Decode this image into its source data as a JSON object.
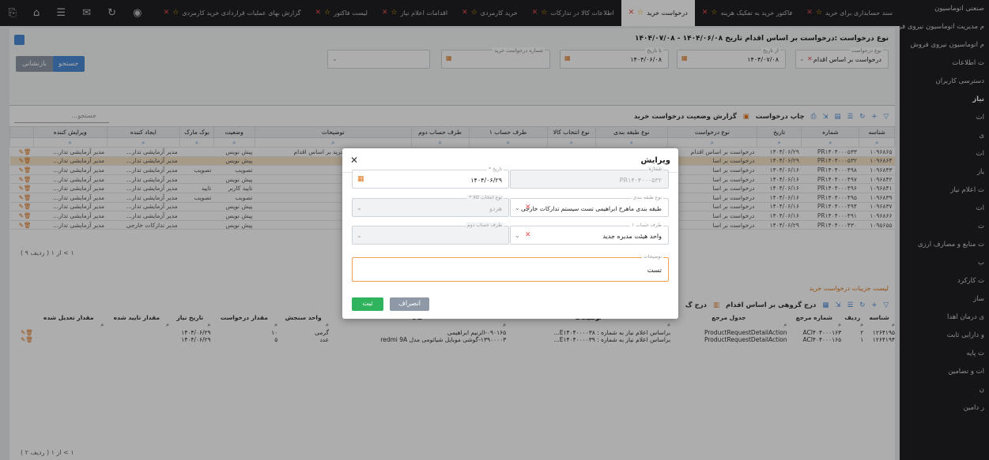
{
  "sidebar": {
    "items": [
      {
        "label": "صنعتی اتوماسیون",
        "bold": false
      },
      {
        "label": "م مدیریت اتوماسیون نیروی فروش",
        "bold": false
      },
      {
        "label": "م اتوماسیون نیروی فروش",
        "bold": false
      },
      {
        "label": "ت اطلاعات",
        "bold": false
      },
      {
        "label": "دسترسی کاربران",
        "bold": false
      },
      {
        "label": "نیاز",
        "bold": true
      },
      {
        "label": "ات",
        "bold": false
      },
      {
        "label": "ی",
        "bold": false
      },
      {
        "label": "ات",
        "bold": false
      },
      {
        "label": "یاز",
        "bold": false
      },
      {
        "label": "ت اعلام نیاز",
        "bold": false
      },
      {
        "label": "ات",
        "bold": false
      },
      {
        "label": "ت",
        "bold": false
      },
      {
        "label": "ت منابع و مصارف ارزی",
        "bold": false
      },
      {
        "label": "ب",
        "bold": false
      },
      {
        "label": "ت کارکرد",
        "bold": false
      },
      {
        "label": "ساز",
        "bold": false
      },
      {
        "label": "ی درمان اهدا",
        "bold": false
      },
      {
        "label": "و دارایی ثابت",
        "bold": false
      },
      {
        "label": "ت پایه",
        "bold": false
      },
      {
        "label": "ات و تضامین",
        "bold": false
      },
      {
        "label": "ن",
        "bold": false
      },
      {
        "label": "ر دامین",
        "bold": false
      }
    ]
  },
  "tabs": [
    {
      "label": "سند حسابداری برای خرید",
      "active": false
    },
    {
      "label": "فاکتور خرید به تفکیک هزینه",
      "active": false
    },
    {
      "label": "درخواست خرید",
      "active": true
    },
    {
      "label": "اطلاعات کالا در تدارکات",
      "active": false
    },
    {
      "label": "خرید کارمزدی",
      "active": false
    },
    {
      "label": "اقدامات اعلام نیاز",
      "active": false
    },
    {
      "label": "لیست فاکتور",
      "active": false
    },
    {
      "label": "گزارش بهای عملیات قراردادی خرید کارمزدی",
      "active": false
    },
    {
      "label": "سفارش خرید کارمزدی",
      "active": false
    }
  ],
  "filter": {
    "title": "نوع درخواست :درخواست بر اساس اقدام   تاریخ ۱۴۰۴/۰۶/۰۸ - ۱۴۰۴/۰۷/۰۸",
    "request_type_label": "نوع درخواست",
    "request_type_value": "درخواست بر اساس اقدام",
    "date_from_label": "از تاریخ",
    "date_from_value": "۱۴۰۴/۰۶/۰۸",
    "date_to_label": "تا تاریخ",
    "date_to_value": "۱۴۰۴/۰۷/۰۸",
    "request_no_label": "شماره درخواست خرید",
    "search_button": "جستجو",
    "reset_button": "بازنشانی"
  },
  "toolbar": {
    "print": "چاپ درخواست",
    "report": "گزارش وضعیت درخواست خرید",
    "search_placeholder": "جستجو..."
  },
  "grid": {
    "headers": [
      "شناسه",
      "شماره",
      "تاریخ",
      "نوع درخواست",
      "نوع طبقه بندی",
      "نوع انتخاب کالا",
      "طرف حساب ۱",
      "طرف حساب دوم",
      "توضیحات",
      "وضعیت",
      "بوک مارک",
      "ایجاد کننده",
      "ویرایش کننده"
    ],
    "filter_all": "(همه)",
    "rows": [
      [
        "۱۰۹۶۸۶۵",
        "PR۱۴۰۴۰۰۰۵۳۳",
        "۱۴۰۴/۰۶/۲۹",
        "درخواست بر اساس اقدام",
        "طبقه بندی ماهرخ ...",
        "هردو",
        "واحد هیئت مدیره جدید",
        "",
        "صدور اتوماتیک درخواست خرید بر اساس اقدام",
        "پیش نویس",
        "",
        "مدیر آزمایشی تدار...",
        "مدیر آزمایشی تدار..."
      ],
      [
        "۱۰۹۶۸۶۴",
        "PR۱۴۰۴۰۰۰۵۳۲",
        "۱۴۰۴/۰۶/۲۹",
        "درخواست بر اسا",
        "",
        "",
        "",
        "",
        "",
        "پیش نویس",
        "",
        "مدیر آزمایشی تدار...",
        "مدیر آزمایشی تدار..."
      ],
      [
        "۱۰۹۶۸۴۳",
        "PR۱۴۰۴۰۰۰۴۹۸",
        "۱۴۰۴/۰۶/۱۶",
        "درخواست بر اسا",
        "",
        "",
        "",
        "",
        "...خرید بر اساس اقدام",
        "تصویب",
        "تصویب",
        "مدیر آزمایشی تدار...",
        "مدیر آزمایشی تدار..."
      ],
      [
        "۱۰۹۶۸۴۲",
        "PR۱۴۰۴۰۰۰۴۹۷",
        "۱۴۰۴/۰۶/۱۶",
        "درخواست بر اسا",
        "",
        "",
        "",
        "",
        "...خرید بر اساس اقدام",
        "پیش نویس",
        "",
        "مدیر آزمایشی تدار...",
        "مدیر آزمایشی تدار..."
      ],
      [
        "۱۰۹۶۸۴۱",
        "PR۱۴۰۴۰۰۰۴۹۶",
        "۱۴۰۴/۰۶/۱۶",
        "درخواست بر اسا",
        "",
        "",
        "",
        "",
        "...خرید بر اساس اقدام",
        "تایید کاربر",
        "تایید",
        "مدیر آزمایشی تدار...",
        "مدیر آزمایشی تدار..."
      ],
      [
        "۱۰۹۶۸۳۹",
        "PR۱۴۰۴۰۰۰۴۹۵",
        "۱۴۰۴/۰۶/۱۶",
        "درخواست بر اسا",
        "",
        "",
        "",
        "",
        "",
        "تصویب",
        "تصویب",
        "مدیر آزمایشی تدار...",
        "مدیر آزمایشی تدار..."
      ],
      [
        "۱۰۹۶۸۳۷",
        "PR۱۴۰۴۰۰۰۴۹۴",
        "۱۴۰۴/۰۶/۱۶",
        "درخواست بر اسا",
        "",
        "",
        "",
        "",
        "",
        "پیش نویس",
        "",
        "مدیر آزمایشی تدار...",
        "مدیر آزمایشی تدار..."
      ],
      [
        "۱۰۹۶۸۶۶",
        "PR۱۴۰۴۰۰۰۴۹۱",
        "۱۴۰۴/۰۶/۱۶",
        "درخواست بر اسا",
        "",
        "",
        "",
        "",
        "",
        "پیش نویس",
        "",
        "مدیر آزمایشی تدار...",
        "مدیر آزمایشی تدار..."
      ],
      [
        "۱۰۹۵۶۵۵",
        "PR۱۴۰۴۰۰۰۴۳۰",
        "۱۴۰۴/۰۶/۲۹",
        "درخواست بر اسا",
        "",
        "",
        "",
        "",
        "",
        "پیش نویس",
        "",
        "مدیر تدارکات خارجی",
        "مدیر آزمایشی تدار..."
      ]
    ],
    "pager": "( ۹ ردیف )   ۱  >  از ۱"
  },
  "subgrid": {
    "title": "لیست جزییات درخواست خرید",
    "toolbar_group": "درج گروهی بر اساس اقدام",
    "toolbar_insert": "درج گ",
    "headers": [
      "شناسه",
      "ردیف",
      "شماره مرجع",
      "جدول مرجع",
      "توضیحات",
      "کالا",
      "واحد سنجش",
      "مقدار درخواست",
      "تاریخ نیاز",
      "مقدار تایید شده",
      "مقدار تعدیل شده"
    ],
    "rows": [
      [
        "۱۲۶۴۱۹۵",
        "۲",
        "ACI۴۰۴۰۰۰۱۶۳",
        "ProductRequestDetailAction",
        "براساس اعلام نیاز به شماره : E۱۴۰۴۰۰۰۰۳۸...",
        "۰۹۰۱۶۵-الزنیم ابراهیمی",
        "گرمی",
        "۱۰",
        "۱۴۰۴/۰۶/۲۹",
        "",
        ""
      ],
      [
        "۱۲۶۴۱۹۴",
        "۱",
        "ACI۴۰۴۰۰۰۱۶۵",
        "ProductRequestDetailAction",
        "براساس اعلام نیاز به شماره : E۱۴۰۴۰۰۰۰۳۹...",
        "۱۳۹۰۰۰۰۳-گوشی موبایل شیائومی مدل redmi 9A",
        "عدد",
        "۵",
        "۱۴۰۴/۰۶/۲۹",
        "",
        ""
      ]
    ],
    "pager": "( ۲ ردیف )   ۱  >  از ۱"
  },
  "dialog": {
    "title": "ویرایش",
    "number_label": "شماره",
    "number_value": "PR۱۴۰۴۰۰۰۵۳۲",
    "date_label": "تاریخ *",
    "date_value": "۱۴۰۴/۰۶/۲۹",
    "classification_label": "نوع طبقه بندی",
    "classification_value": "طبقه بندی ماهرخ ابراهیمی تست سیستم تدارکات خارجی",
    "goods_selection_label": "نوع انتخاب کالا *",
    "goods_selection_value": "هردو",
    "account1_label": "طرف حساب ۱",
    "account1_value": "واحد هیئت مدیره جدید",
    "account2_label": "طرف حساب دوم",
    "account2_value": "",
    "description_label": "توضیحات",
    "description_value": "تست",
    "save_button": "ثبت",
    "cancel_button": "انصراف"
  },
  "colors": {
    "accent": "#4c8bd6",
    "save": "#2fb35c",
    "warning": "#e07a22",
    "selected_row": "#f6e4c6",
    "sidebar": "#202024"
  }
}
